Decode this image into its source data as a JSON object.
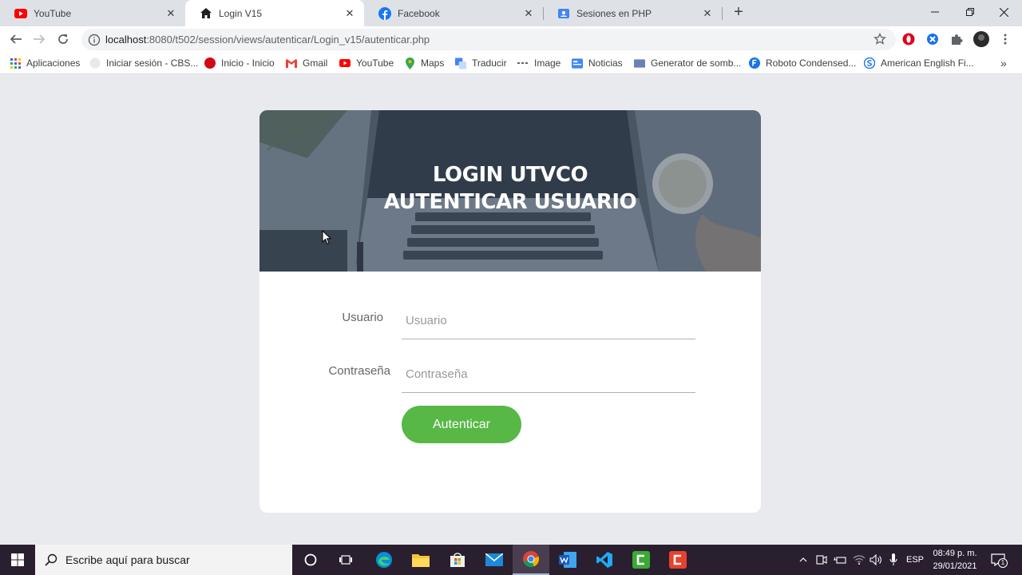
{
  "browser": {
    "tabs": [
      {
        "title": "YouTube",
        "icon": "youtube-icon"
      },
      {
        "title": "Login V15",
        "icon": "home-icon"
      },
      {
        "title": "Facebook",
        "icon": "facebook-icon"
      },
      {
        "title": "Sesiones en PHP",
        "icon": "contact-card-icon"
      }
    ],
    "new_tab_label": "+",
    "address": {
      "host": "localhost",
      "path": ":8080/t502/session/views/autenticar/Login_v15/autenticar.php"
    },
    "bookmarks": [
      {
        "label": "Aplicaciones",
        "icon": "apps-grid-icon"
      },
      {
        "label": "Iniciar sesión - CBS...",
        "icon": "globe-icon"
      },
      {
        "label": "Inicio - Inicio",
        "icon": "red-circle-icon"
      },
      {
        "label": "Gmail",
        "icon": "gmail-icon"
      },
      {
        "label": "YouTube",
        "icon": "youtube-icon"
      },
      {
        "label": "Maps",
        "icon": "maps-pin-icon"
      },
      {
        "label": "Traducir",
        "icon": "translate-icon"
      },
      {
        "label": "Image",
        "icon": "dashes-icon"
      },
      {
        "label": "Noticias",
        "icon": "news-icon"
      },
      {
        "label": "Generator de somb...",
        "icon": "folder-icon"
      },
      {
        "label": "Roboto Condensed...",
        "icon": "font-f-icon"
      },
      {
        "label": "American English Fi...",
        "icon": "s-logo-icon"
      }
    ],
    "bookmarks_overflow": "»"
  },
  "page": {
    "title_line1": "LOGIN UTVCO",
    "title_line2": "AUTENTICAR USUARIO",
    "username_label": "Usuario",
    "username_placeholder": "Usuario",
    "password_label": "Contraseña",
    "password_placeholder": "Contraseña",
    "submit_label": "Autenticar",
    "accent_color": "#57b846"
  },
  "taskbar": {
    "search_placeholder": "Escribe aquí para buscar",
    "language": "ESP",
    "time": "08:49 p. m.",
    "date": "29/01/2021",
    "notification_count": "1"
  }
}
